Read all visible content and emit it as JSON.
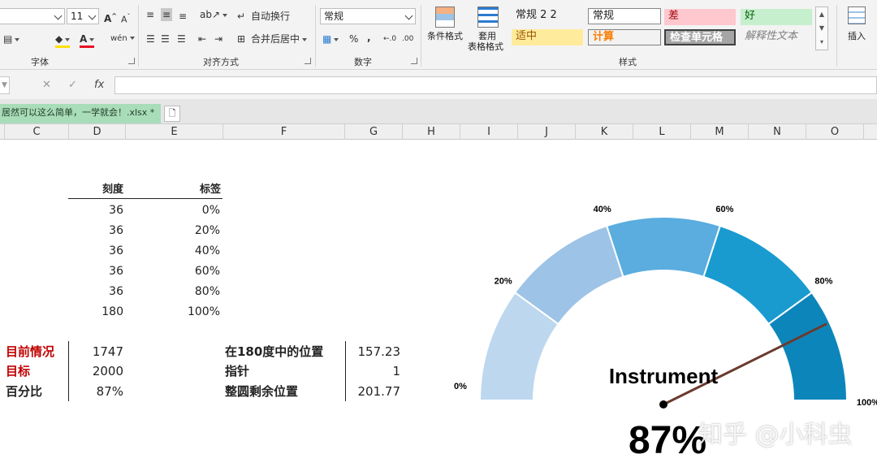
{
  "ribbon": {
    "font_size": "11",
    "font_group_label": "字体",
    "align_group_label": "对齐方式",
    "number_group_label": "数字",
    "styles_group_label": "样式",
    "wrap_text_label": "自动换行",
    "merge_center_label": "合并后居中",
    "number_format": "常规",
    "cond_format_label": "条件格式",
    "table_format_label_1": "套用",
    "table_format_label_2": "表格格式",
    "insert_label": "插入",
    "percent_symbol": "%",
    "comma_symbol": ",",
    "styles": [
      {
        "label": "常规 2 2",
        "bg": "#ffffff",
        "color": "#000000"
      },
      {
        "label": "常规",
        "bg": "#ffffff",
        "color": "#000000"
      },
      {
        "label": "差",
        "bg": "#ffc7ce",
        "color": "#9c0006"
      },
      {
        "label": "好",
        "bg": "#c6efce",
        "color": "#006100"
      },
      {
        "label": "适中",
        "bg": "#ffeb9c",
        "color": "#9c5700"
      },
      {
        "label": "计算",
        "bg": "#f2f2f2",
        "color": "#fa7d00"
      },
      {
        "label": "检查单元格",
        "bg": "#a5a5a5",
        "color": "#ffffff"
      },
      {
        "label": "解释性文本",
        "bg": "#ffffff",
        "color": "#7f7f7f"
      }
    ]
  },
  "formula_bar": {
    "cancel_icon": "✕",
    "enter_icon": "✓",
    "fx_label": "fx",
    "content": ""
  },
  "tab": {
    "doc_name": "居然可以这么简单，一学就会！.xlsx *"
  },
  "columns": [
    "C",
    "D",
    "E",
    "F",
    "G",
    "H",
    "I",
    "J",
    "K",
    "L",
    "M",
    "N",
    "O"
  ],
  "table1": {
    "headers": [
      "刻度",
      "标签"
    ],
    "rows": [
      [
        "36",
        "0%"
      ],
      [
        "36",
        "20%"
      ],
      [
        "36",
        "40%"
      ],
      [
        "36",
        "60%"
      ],
      [
        "36",
        "80%"
      ],
      [
        "180",
        "100%"
      ]
    ]
  },
  "summary": [
    {
      "label": "目前情况",
      "value": "1747"
    },
    {
      "label": "目标",
      "value": "2000"
    },
    {
      "label": "百分比",
      "value": "87%"
    }
  ],
  "calc": [
    {
      "label": "在180度中的位置",
      "value": "157.23"
    },
    {
      "label": "指针",
      "value": "1"
    },
    {
      "label": "整圆剩余位置",
      "value": "201.77"
    }
  ],
  "gauge": {
    "title": "Instrument",
    "value_text": "87%",
    "needle_degrees": 157.23,
    "tick_labels": [
      "0%",
      "20%",
      "40%",
      "60%",
      "80%",
      "100%"
    ],
    "segment_colors": [
      "#bdd7ee",
      "#9dc3e6",
      "#5aadde",
      "#1a9bd0",
      "#0c86ba"
    ],
    "needle_color": "#6b3a2e"
  },
  "watermark": "知乎 @小科虫"
}
